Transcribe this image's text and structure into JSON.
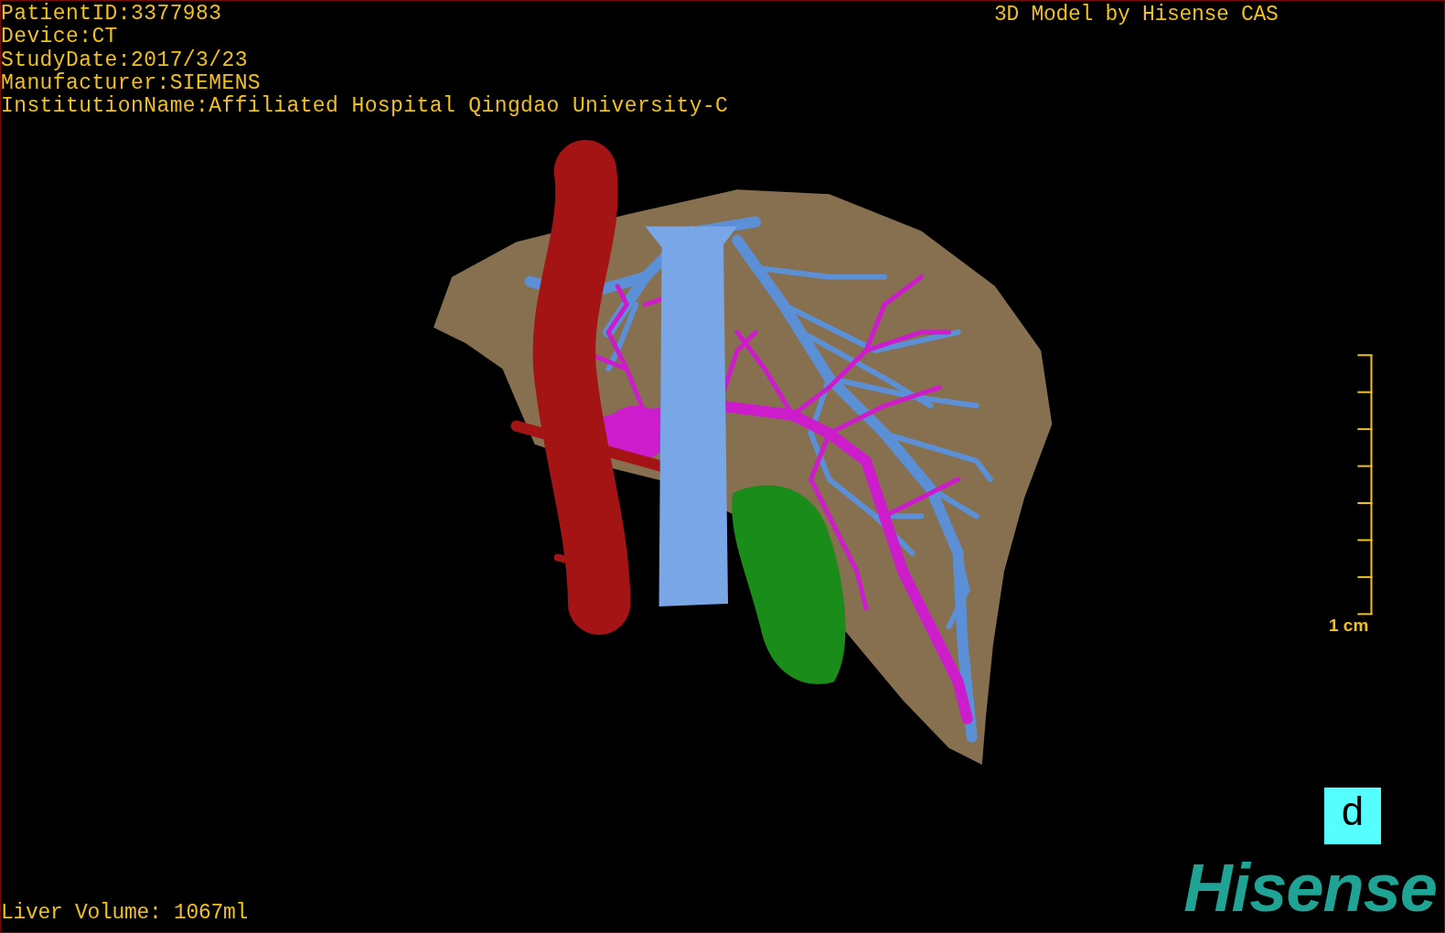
{
  "patient_info": [
    "PatientID:3377983",
    "Device:CT",
    "StudyDate:2017/3/23",
    "Manufacturer:SIEMENS",
    "InstitutionName:Affiliated Hospital Qingdao University-C"
  ],
  "header_title": "3D Model by Hisense CAS",
  "scale_bar": {
    "label": "1 cm"
  },
  "orientation_label": "d",
  "logo": "Hisense",
  "liver_volume": "Liver Volume: 1067ml"
}
